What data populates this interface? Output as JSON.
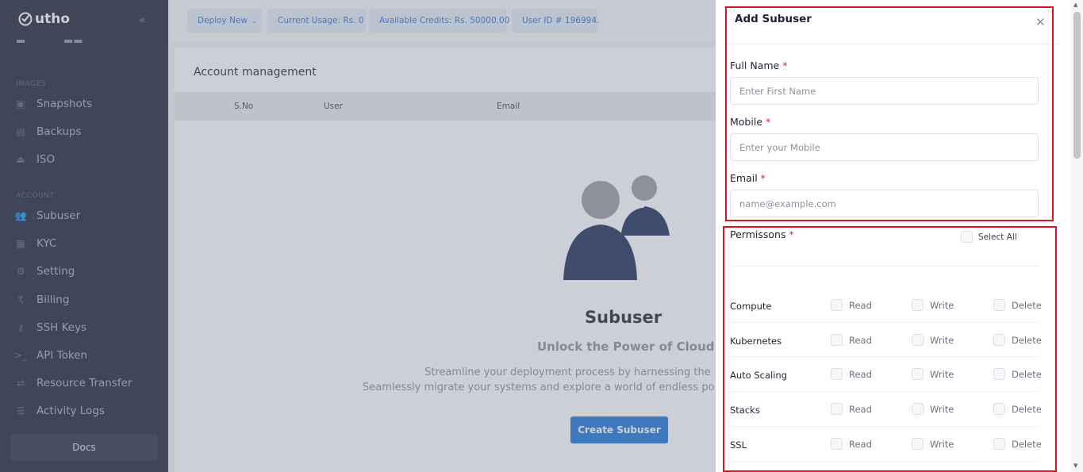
{
  "logo": {
    "text": "utho"
  },
  "sidebar": {
    "sections": [
      {
        "label": "IMAGES",
        "items": [
          {
            "label": "Snapshots",
            "icon": "snapshot-icon"
          },
          {
            "label": "Backups",
            "icon": "backup-icon"
          },
          {
            "label": "ISO",
            "icon": "iso-icon"
          }
        ]
      },
      {
        "label": "ACCOUNT",
        "items": [
          {
            "label": "Subuser",
            "icon": "subuser-icon"
          },
          {
            "label": "KYC",
            "icon": "kyc-icon"
          },
          {
            "label": "Setting",
            "icon": "gear-icon"
          },
          {
            "label": "Billing",
            "icon": "rupee-icon"
          },
          {
            "label": "SSH Keys",
            "icon": "key-icon"
          },
          {
            "label": "API Token",
            "icon": "terminal-icon"
          },
          {
            "label": "Resource Transfer",
            "icon": "transfer-icon"
          },
          {
            "label": "Activity Logs",
            "icon": "log-icon"
          }
        ]
      }
    ],
    "docs_label": "Docs"
  },
  "topbar": {
    "deploy_label": "Deploy New",
    "usage": "Current Usage: Rs. 0",
    "credits": "Available Credits: Rs. 50000.00",
    "user_id": "User ID # 196994."
  },
  "main": {
    "title": "Account management",
    "columns": [
      "S.No",
      "User",
      "Email"
    ],
    "empty": {
      "title": "Subuser",
      "subtitle": "Unlock the Power of Cloud",
      "desc1": "Streamline your deployment process by harnessing the",
      "desc2": "Seamlessly migrate your systems and explore a world of endless po",
      "button": "Create Subuser"
    }
  },
  "drawer": {
    "title": "Add Subuser",
    "full_name": {
      "label": "Full Name",
      "placeholder": "Enter First Name",
      "value": ""
    },
    "mobile": {
      "label": "Mobile",
      "placeholder": "Enter your Mobile",
      "value": ""
    },
    "email": {
      "label": "Email",
      "placeholder": "name@example.com",
      "value": ""
    },
    "permissions_label": "Permissons",
    "select_all": "Select All",
    "required_mark": "*",
    "perm_options": [
      "Read",
      "Write",
      "Delete"
    ],
    "permissions": [
      "Compute",
      "Kubernetes",
      "Auto Scaling",
      "Stacks",
      "SSL"
    ]
  },
  "colors": {
    "sidebar": "#1e2235",
    "accent": "#1a73d9",
    "highlight": "#e0121f",
    "required": "#e0233a"
  }
}
